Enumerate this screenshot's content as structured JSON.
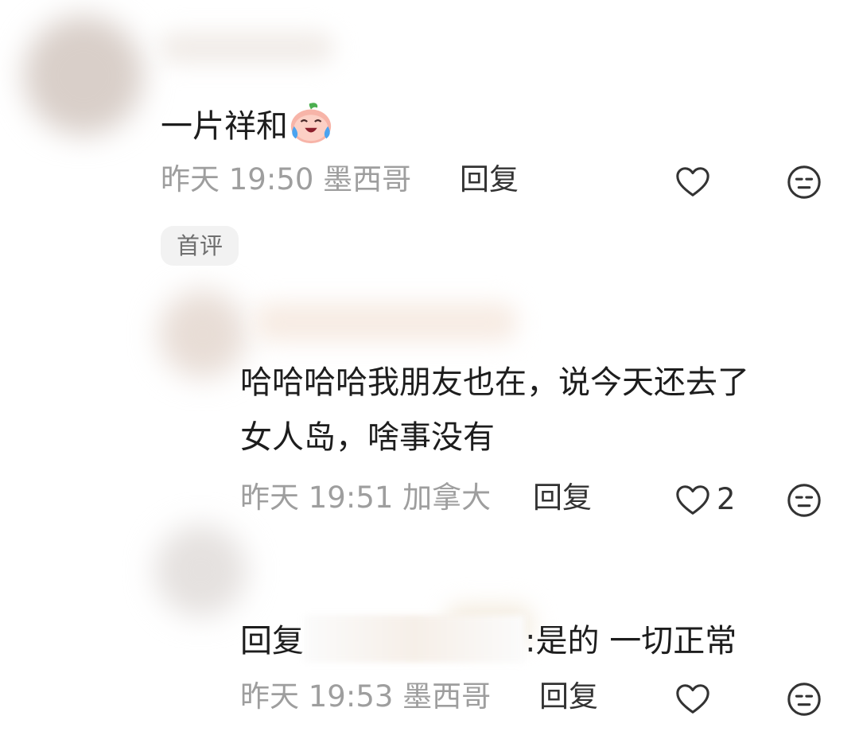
{
  "comments": [
    {
      "text": "一片祥和",
      "emoji": "crying-laughing-peach-emoji",
      "date": "昨天",
      "time": "19:50",
      "location": "墨西哥",
      "reply_label": "回复",
      "badge": "首评",
      "like_count": ""
    },
    {
      "text_line1": "哈哈哈哈我朋友也在，说今天还去了",
      "text_line2": "女人岛，啥事没有",
      "date": "昨天",
      "time": "19:51",
      "location": "加拿大",
      "reply_label": "回复",
      "like_count": "2"
    },
    {
      "reply_prefix": "回复",
      "text": ":是的 一切正常",
      "date": "昨天",
      "time": "19:53",
      "location": "墨西哥",
      "reply_label": "回复",
      "like_count": ""
    }
  ],
  "icons": {
    "like": "heart-outline-icon",
    "dislike": "neutral-face-icon"
  },
  "colors": {
    "meta_text": "#9e9e9e",
    "body_text": "#1d1d1d",
    "badge_bg": "#f2f2f2"
  }
}
